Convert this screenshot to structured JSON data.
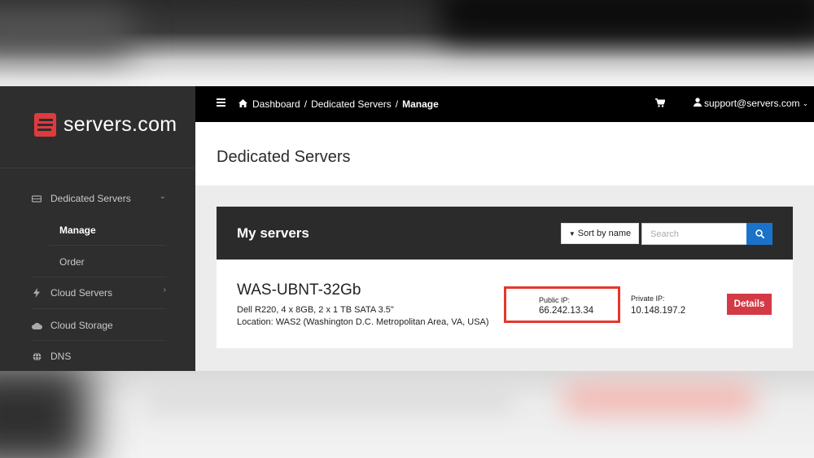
{
  "brand": {
    "name": "servers.com",
    "logo_color": "#e03a3e"
  },
  "sidebar": {
    "items": [
      {
        "label": "Dedicated Servers",
        "icon": "hard-drive-icon",
        "has_chevron": "down"
      },
      {
        "label": "Cloud Servers",
        "icon": "bolt-icon",
        "has_chevron": "right"
      },
      {
        "label": "Cloud Storage",
        "icon": "cloud-icon"
      },
      {
        "label": "DNS",
        "icon": "globe-icon"
      }
    ],
    "subitems": [
      {
        "label": "Manage",
        "active": true
      },
      {
        "label": "Order",
        "active": false
      }
    ]
  },
  "topbar": {
    "breadcrumb": [
      "Dashboard",
      "Dedicated Servers",
      "Manage"
    ],
    "separator": "/",
    "user_email": "support@servers.com"
  },
  "page": {
    "title": "Dedicated Servers"
  },
  "panel": {
    "title": "My servers",
    "sort_label": "Sort by name",
    "search_placeholder": "Search"
  },
  "server": {
    "name": "WAS-UBNT-32Gb",
    "spec": "Dell R220, 4 x 8GB, 2 x 1 TB SATA 3.5\"",
    "location": "Location: WAS2 (Washington D.C. Metropolitan Area, VA, USA)",
    "public_ip_label": "Public IP:",
    "public_ip": "66.242.13.34",
    "private_ip_label": "Private IP:",
    "private_ip": "10.148.197.2",
    "details_label": "Details"
  },
  "colors": {
    "accent_blue": "#1a73c9",
    "details_red": "#d33a45",
    "highlight_red": "#e5372b"
  }
}
